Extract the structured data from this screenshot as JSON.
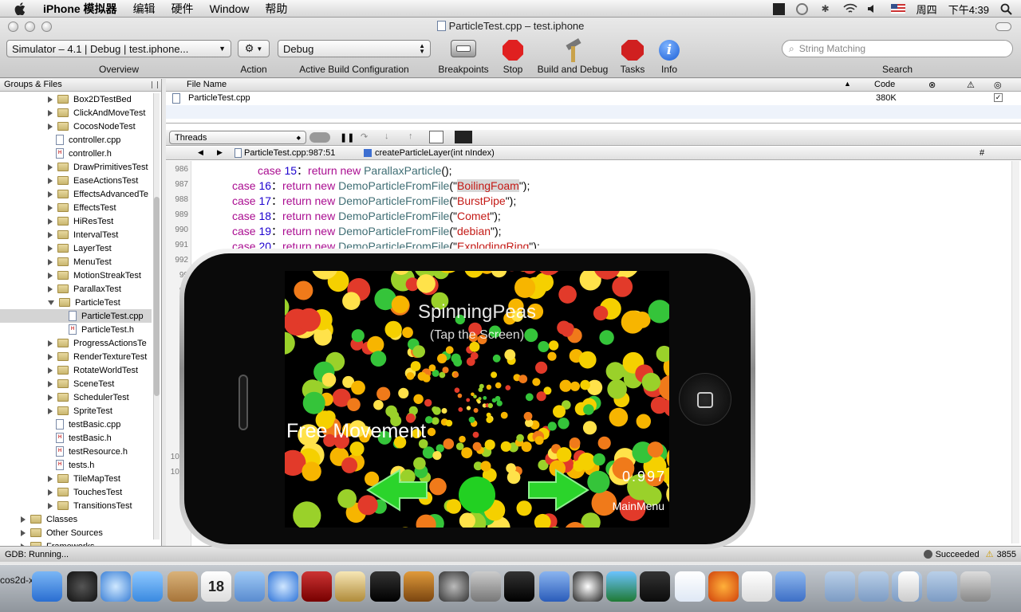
{
  "menubar": {
    "app": "iPhone 模拟器",
    "items": [
      "编辑",
      "硬件",
      "Window",
      "帮助"
    ],
    "day": "周四",
    "time": "下午4:39"
  },
  "window": {
    "title": "ParticleTest.cpp – test.iphone"
  },
  "toolbar": {
    "overview_value": "Simulator – 4.1 | Debug | test.iphone...",
    "overview_label": "Overview",
    "action_label": "Action",
    "config_value": "Debug",
    "config_label": "Active Build Configuration",
    "breakpoints_label": "Breakpoints",
    "stop_label": "Stop",
    "build_label": "Build and Debug",
    "tasks_label": "Tasks",
    "info_label": "Info",
    "search_placeholder": "String Matching",
    "search_label": "Search"
  },
  "groups_header": "Groups & Files",
  "tree": [
    {
      "label": "Box2DTestBed",
      "type": "folder"
    },
    {
      "label": "ClickAndMoveTest",
      "type": "folder"
    },
    {
      "label": "CocosNodeTest",
      "type": "folder"
    },
    {
      "label": "controller.cpp",
      "type": "cpp"
    },
    {
      "label": "controller.h",
      "type": "h"
    },
    {
      "label": "DrawPrimitivesTest",
      "type": "folder"
    },
    {
      "label": "EaseActionsTest",
      "type": "folder"
    },
    {
      "label": "EffectsAdvancedTe",
      "type": "folder"
    },
    {
      "label": "EffectsTest",
      "type": "folder"
    },
    {
      "label": "HiResTest",
      "type": "folder"
    },
    {
      "label": "IntervalTest",
      "type": "folder"
    },
    {
      "label": "LayerTest",
      "type": "folder"
    },
    {
      "label": "MenuTest",
      "type": "folder"
    },
    {
      "label": "MotionStreakTest",
      "type": "folder"
    },
    {
      "label": "ParallaxTest",
      "type": "folder"
    },
    {
      "label": "ParticleTest",
      "type": "folder-open"
    },
    {
      "label": "ParticleTest.cpp",
      "type": "cpp-child",
      "selected": true
    },
    {
      "label": "ParticleTest.h",
      "type": "h-child"
    },
    {
      "label": "ProgressActionsTe",
      "type": "folder"
    },
    {
      "label": "RenderTextureTest",
      "type": "folder"
    },
    {
      "label": "RotateWorldTest",
      "type": "folder"
    },
    {
      "label": "SceneTest",
      "type": "folder"
    },
    {
      "label": "SchedulerTest",
      "type": "folder"
    },
    {
      "label": "SpriteTest",
      "type": "folder"
    },
    {
      "label": "testBasic.cpp",
      "type": "cpp"
    },
    {
      "label": "testBasic.h",
      "type": "h"
    },
    {
      "label": "testResource.h",
      "type": "h"
    },
    {
      "label": "tests.h",
      "type": "h"
    },
    {
      "label": "TileMapTest",
      "type": "folder"
    },
    {
      "label": "TouchesTest",
      "type": "folder"
    },
    {
      "label": "TransitionsTest",
      "type": "folder"
    },
    {
      "label": "Classes",
      "type": "root"
    },
    {
      "label": "Other Sources",
      "type": "root"
    },
    {
      "label": "Frameworks",
      "type": "root"
    }
  ],
  "filelist": {
    "col_name": "File Name",
    "col_code": "Code",
    "row_name": "ParticleTest.cpp",
    "row_code": "380K"
  },
  "debugbar": {
    "threads": "Threads"
  },
  "navbar": {
    "location": "ParticleTest.cpp:987:51",
    "function": "createParticleLayer(int nIndex)",
    "hash": "#"
  },
  "code_lines": [
    {
      "n": "986",
      "parts": [
        [
          "kw",
          "case "
        ],
        [
          "num",
          "15"
        ],
        [
          "",
          "："
        ],
        [
          "kw",
          "return new "
        ],
        [
          "cls",
          "ParallaxParticle"
        ],
        [
          "",
          "();"
        ]
      ],
      "indent": 70
    },
    {
      "n": "987",
      "parts": [
        [
          "kw",
          "case "
        ],
        [
          "num",
          "16"
        ],
        [
          "",
          "："
        ],
        [
          "kw",
          "return new "
        ],
        [
          "cls",
          "DemoParticleFromFile"
        ],
        [
          "",
          "(\""
        ],
        [
          "str",
          "BoilingFoam"
        ],
        [
          "",
          "\");"
        ]
      ],
      "indent": 38
    },
    {
      "n": "988",
      "parts": [
        [
          "kw",
          "case "
        ],
        [
          "num",
          "17"
        ],
        [
          "",
          "："
        ],
        [
          "kw",
          "return new "
        ],
        [
          "cls",
          "DemoParticleFromFile"
        ],
        [
          "",
          "(\""
        ],
        [
          "str",
          "BurstPipe"
        ],
        [
          "",
          "\");"
        ]
      ],
      "indent": 38
    },
    {
      "n": "989",
      "parts": [
        [
          "kw",
          "case "
        ],
        [
          "num",
          "18"
        ],
        [
          "",
          "："
        ],
        [
          "kw",
          "return new "
        ],
        [
          "cls",
          "DemoParticleFromFile"
        ],
        [
          "",
          "(\""
        ],
        [
          "str",
          "Comet"
        ],
        [
          "",
          "\");"
        ]
      ],
      "indent": 38
    },
    {
      "n": "990",
      "parts": [
        [
          "kw",
          "case "
        ],
        [
          "num",
          "19"
        ],
        [
          "",
          "："
        ],
        [
          "kw",
          "return new "
        ],
        [
          "cls",
          "DemoParticleFromFile"
        ],
        [
          "",
          "(\""
        ],
        [
          "str",
          "debian"
        ],
        [
          "",
          "\");"
        ]
      ],
      "indent": 38
    },
    {
      "n": "991",
      "parts": [
        [
          "kw",
          "case "
        ],
        [
          "num",
          "20"
        ],
        [
          "",
          "："
        ],
        [
          "kw",
          "return new "
        ],
        [
          "cls",
          "DemoParticleFromFile"
        ],
        [
          "",
          "(\""
        ],
        [
          "str",
          "ExplodingRing"
        ],
        [
          "",
          "\");"
        ]
      ],
      "indent": 38
    }
  ],
  "line_numbers_partial": [
    "992",
    "99",
    "99",
    "9",
    "9",
    "9",
    "10",
    "10",
    "10",
    "10",
    "10",
    "10",
    "10",
    "1000",
    "1010"
  ],
  "sim": {
    "title": "SpinningPeas",
    "subtitle": "(Tap the Screen)",
    "mode": "Free Movement",
    "fps": "0.997",
    "menu": "MainMenu"
  },
  "status": {
    "left": "GDB: Running...",
    "result": "Succeeded",
    "count": "3855"
  },
  "dock": {
    "label_left": "cos2d-x",
    "calendar_day": "18"
  }
}
